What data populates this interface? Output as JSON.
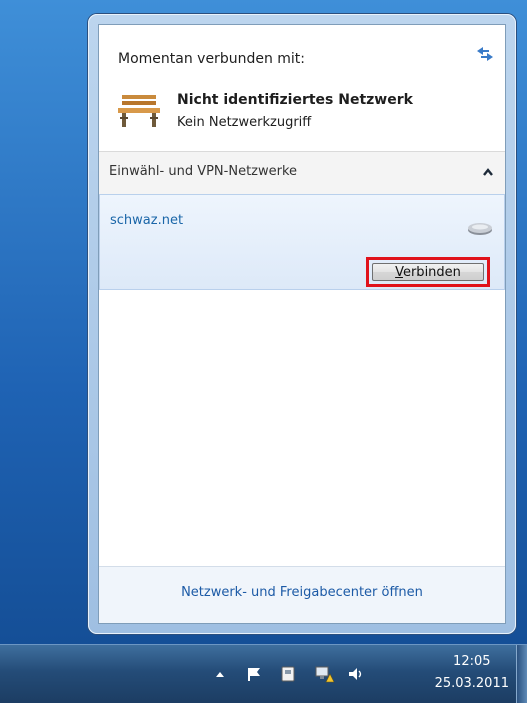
{
  "flyout": {
    "connected_title": "Momentan verbunden mit:",
    "network_name": "Nicht identifiziertes Netzwerk",
    "network_status": "Kein Netzwerkzugriff",
    "section_label": "Einwähl- und VPN-Netzwerke",
    "connection_name": "schwaz.net",
    "connect_button": {
      "accel": "V",
      "rest": "erbinden"
    },
    "footer_link": "Netzwerk- und Freigabecenter öffnen"
  },
  "taskbar": {
    "time": "12:05",
    "date": "25.03.2011"
  },
  "colors": {
    "highlight": "#e0121b",
    "link": "#1c5aa6",
    "desktop": "#1f63b4"
  },
  "icons": [
    "refresh-icon",
    "bench-network-icon",
    "collapse-up-icon",
    "modem-icon",
    "show-hidden-icons-arrow",
    "action-center-flag-icon",
    "device-icon",
    "network-warning-icon",
    "speaker-icon"
  ]
}
